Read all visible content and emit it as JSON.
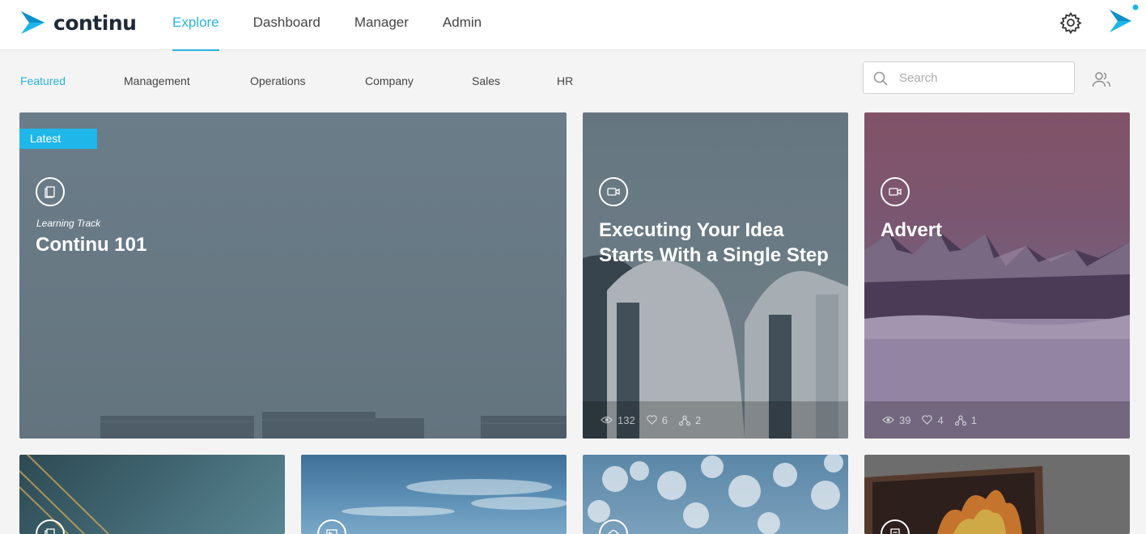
{
  "brand": {
    "name": "continu"
  },
  "nav": {
    "items": [
      {
        "label": "Explore",
        "active": true
      },
      {
        "label": "Dashboard",
        "active": false
      },
      {
        "label": "Manager",
        "active": false
      },
      {
        "label": "Admin",
        "active": false
      }
    ]
  },
  "subnav": {
    "items": [
      {
        "label": "Featured",
        "active": true
      },
      {
        "label": "Management",
        "active": false
      },
      {
        "label": "Operations",
        "active": false
      },
      {
        "label": "Company",
        "active": false
      },
      {
        "label": "Sales",
        "active": false
      },
      {
        "label": "HR",
        "active": false
      }
    ]
  },
  "search": {
    "placeholder": "Search"
  },
  "colors": {
    "accent": "#2bb3e0",
    "badge": "#1fb6ea"
  },
  "cards": [
    {
      "badge": "Latest",
      "icon": "learning-track-icon",
      "kicker": "Learning Track",
      "title": "Continu 101"
    },
    {
      "icon": "video-icon",
      "title": "Executing Your Idea Starts With a Single Step",
      "views": "132",
      "likes": "6",
      "shares": "2"
    },
    {
      "icon": "video-icon",
      "title": "Advert",
      "views": "39",
      "likes": "4",
      "shares": "1"
    },
    {
      "icon": "learning-track-icon"
    },
    {
      "icon": "slides-icon"
    },
    {
      "icon": "cloud-icon"
    },
    {
      "icon": "document-icon"
    }
  ]
}
